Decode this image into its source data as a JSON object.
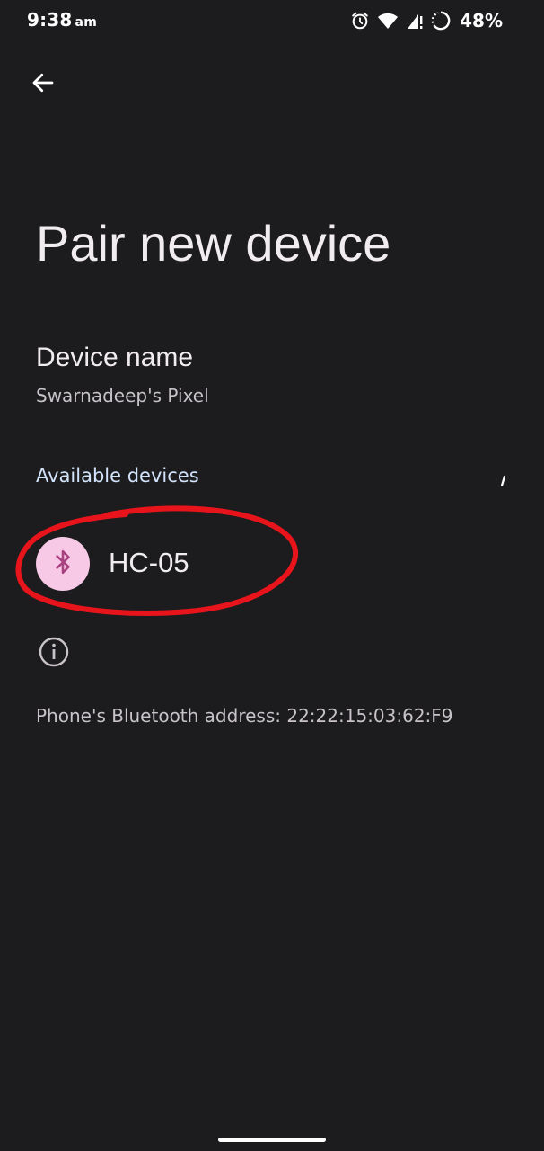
{
  "status_bar": {
    "time": "9:38",
    "ampm": "am",
    "battery_percent": "48%",
    "icons": [
      "alarm-icon",
      "wifi-icon",
      "cellular-signal-icon",
      "battery-saver-icon"
    ]
  },
  "header": {
    "back_icon": "arrow-left-icon"
  },
  "page": {
    "title": "Pair new device"
  },
  "device_name": {
    "title": "Device name",
    "value": "Swarnadeep's Pixel"
  },
  "available_devices": {
    "header": "Available devices",
    "items": [
      {
        "label": "HC-05",
        "icon": "bluetooth-icon"
      }
    ]
  },
  "footer": {
    "info_icon": "info-icon",
    "bt_address": "Phone's Bluetooth address: 22:22:15:03:62:F9"
  },
  "colors": {
    "background": "#1c1c1e",
    "text_primary": "#f0ecf0",
    "text_secondary": "#c8c3c9",
    "section_header": "#d2e3fc",
    "bluetooth_circle": "#f7c9e6",
    "bluetooth_glyph": "#a8417f",
    "annotation_red": "#e8141b"
  }
}
